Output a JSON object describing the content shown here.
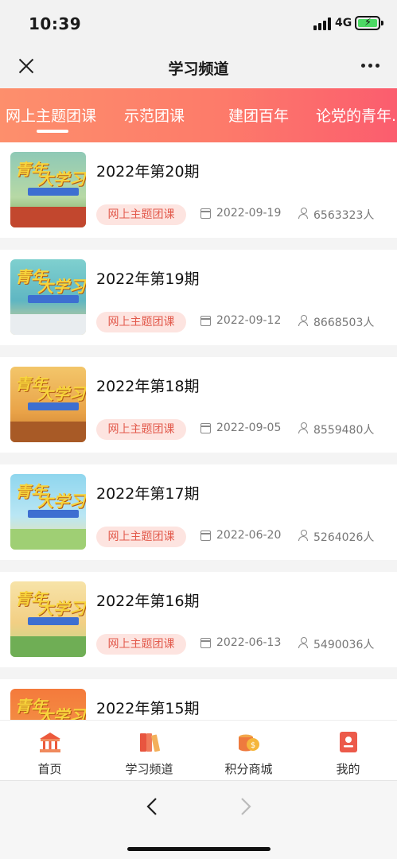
{
  "status_bar": {
    "time": "10:39",
    "network": "4G"
  },
  "nav": {
    "title": "学习频道"
  },
  "tabs": [
    {
      "label": "网上主题团课",
      "active": true
    },
    {
      "label": "示范团课",
      "active": false
    },
    {
      "label": "建团百年",
      "active": false
    },
    {
      "label": "论党的青年...",
      "active": false
    }
  ],
  "items": [
    {
      "title": "2022年第20期",
      "tag": "网上主题团课",
      "date": "2022-09-19",
      "count": "6563323人"
    },
    {
      "title": "2022年第19期",
      "tag": "网上主题团课",
      "date": "2022-09-12",
      "count": "8668503人"
    },
    {
      "title": "2022年第18期",
      "tag": "网上主题团课",
      "date": "2022-09-05",
      "count": "8559480人"
    },
    {
      "title": "2022年第17期",
      "tag": "网上主题团课",
      "date": "2022-06-20",
      "count": "5264026人"
    },
    {
      "title": "2022年第16期",
      "tag": "网上主题团课",
      "date": "2022-06-13",
      "count": "5490036人"
    },
    {
      "title": "2022年第15期",
      "tag": "",
      "date": "",
      "count": ""
    }
  ],
  "bottom_nav": [
    {
      "label": "首页",
      "icon": "home-icon"
    },
    {
      "label": "学习频道",
      "icon": "books-icon"
    },
    {
      "label": "积分商城",
      "icon": "coins-icon"
    },
    {
      "label": "我的",
      "icon": "profile-icon"
    }
  ],
  "colors": {
    "accent": "#fb5d6e",
    "tag_bg": "#fde4e0",
    "tag_text": "#e25a4c"
  }
}
